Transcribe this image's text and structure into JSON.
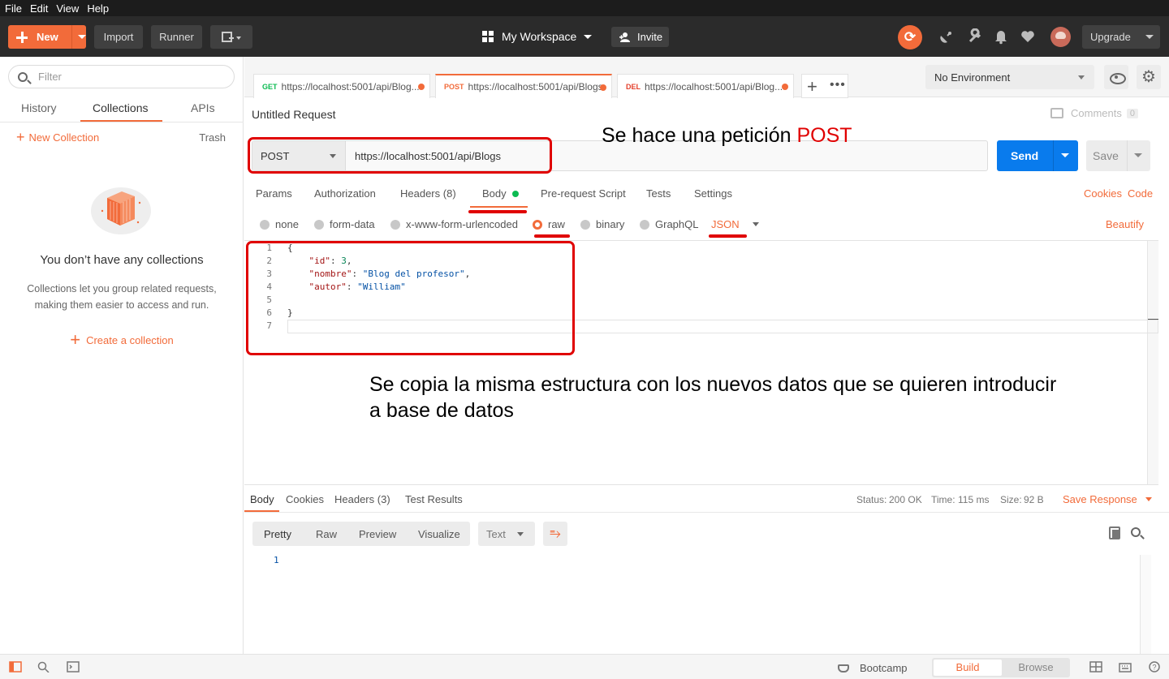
{
  "menu": [
    "File",
    "Edit",
    "View",
    "Help"
  ],
  "header": {
    "new_label": "New",
    "import_label": "Import",
    "runner_label": "Runner",
    "workspace_label": "My Workspace",
    "invite_label": "Invite",
    "upgrade_label": "Upgrade"
  },
  "sidebar": {
    "filter_placeholder": "Filter",
    "tabs": [
      "History",
      "Collections",
      "APIs"
    ],
    "active_tab": "Collections",
    "new_collection": "New Collection",
    "trash": "Trash",
    "empty_title": "You don’t have any collections",
    "empty_desc_1": "Collections let you group related requests,",
    "empty_desc_2": "making them easier to access and run.",
    "create_label": "Create a collection"
  },
  "tabs": [
    {
      "method": "GET",
      "url": "https://localhost:5001/api/Blog...",
      "method_color": "#0cbb52"
    },
    {
      "method": "POST",
      "url": "https://localhost:5001/api/Blogs",
      "method_color": "#f26b3a"
    },
    {
      "method": "DEL",
      "url": "https://localhost:5001/api/Blog...",
      "method_color": "#e4402c"
    }
  ],
  "environment": "No Environment",
  "request": {
    "title": "Untitled Request",
    "comments_label": "Comments",
    "comments_count": "0",
    "method": "POST",
    "url": "https://localhost:5001/api/Blogs",
    "send_label": "Send",
    "save_label": "Save"
  },
  "request_tabs": {
    "params": "Params",
    "authorization": "Authorization",
    "headers": "Headers",
    "headers_count": "(8)",
    "body": "Body",
    "prerequest": "Pre-request Script",
    "tests": "Tests",
    "settings": "Settings",
    "cookies": "Cookies",
    "code": "Code"
  },
  "body_types": {
    "none": "none",
    "form_data": "form-data",
    "urlencoded": "x-www-form-urlencoded",
    "raw": "raw",
    "binary": "binary",
    "graphql": "GraphQL",
    "format": "JSON",
    "beautify": "Beautify"
  },
  "code": {
    "line_numbers": [
      "1",
      "2",
      "3",
      "4",
      "5",
      "6",
      "7"
    ],
    "open_brace": "{",
    "close_brace": "}",
    "id_key": "\"id\"",
    "id_val": "3",
    "nombre_key": "\"nombre\"",
    "nombre_val": "\"Blog del profesor\"",
    "autor_key": "\"autor\"",
    "autor_val": "\"William\""
  },
  "response": {
    "tabs": {
      "body": "Body",
      "cookies": "Cookies",
      "headers": "Headers",
      "headers_count": "(3)",
      "test_results": "Test Results"
    },
    "status_label": "Status:",
    "status_value": "200 OK",
    "time_label": "Time:",
    "time_value": "115 ms",
    "size_label": "Size:",
    "size_value": "92 B",
    "save_response": "Save Response",
    "views": [
      "Pretty",
      "Raw",
      "Preview",
      "Visualize"
    ],
    "format": "Text",
    "line_1": "1"
  },
  "footer": {
    "bootcamp": "Bootcamp",
    "build": "Build",
    "browse": "Browse"
  },
  "annotations": {
    "top_black": "Se hace una petición ",
    "top_red": "POST",
    "bottom_line1": "Se copia la misma estructura con los nuevos datos que se quieren introducir",
    "bottom_line2": "a base de datos"
  },
  "colors": {
    "accent": "#f26b3a",
    "send_blue": "#097bed",
    "annotation_red": "#e00000",
    "success_green": "#0cbb52"
  }
}
